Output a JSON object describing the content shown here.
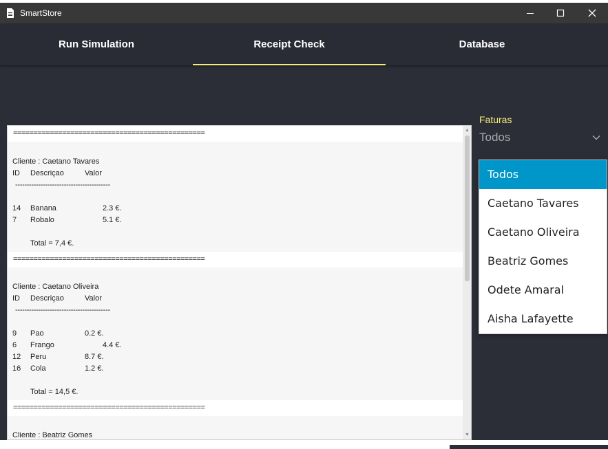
{
  "window": {
    "title": "SmartStore",
    "app_icon": "document-icon",
    "controls": [
      "minimize-icon",
      "maximize-icon",
      "close-icon"
    ]
  },
  "tabs": [
    {
      "label": "Run Simulation",
      "active": false
    },
    {
      "label": "Receipt Check",
      "active": true
    },
    {
      "label": "Database",
      "active": false
    }
  ],
  "colors": {
    "accent": "#f5ec7a",
    "selection": "#0096c9",
    "background": "#2b2e37"
  },
  "filter": {
    "label": "Faturas",
    "selected": "Todos",
    "options": [
      "Todos",
      "Caetano Tavares",
      "Caetano Oliveira",
      "Beatriz Gomes",
      "Odete Amaral",
      "Aisha Lafayette"
    ]
  },
  "receipt": {
    "separator": "===============================================",
    "header": {
      "id": "ID",
      "desc": "Descriçao",
      "val": "Valor"
    },
    "dash_line": "-----------------------------------------",
    "customers": [
      {
        "cliente": "Cliente : Caetano Tavares",
        "items": [
          {
            "id": "14",
            "desc": "Banana",
            "val": "2.3 €."
          },
          {
            "id": "7",
            "desc": "Robalo",
            "val": "5.1 €."
          }
        ],
        "total": "Total = 7,4 €."
      },
      {
        "cliente": "Cliente : Caetano Oliveira",
        "items": [
          {
            "id": "9",
            "desc": "Pao",
            "val": "0.2 €."
          },
          {
            "id": "6",
            "desc": "Frango",
            "val": "4.4 €."
          },
          {
            "id": "12",
            "desc": "Peru",
            "val": "8.7 €."
          },
          {
            "id": "16",
            "desc": "Cola",
            "val": "1.2 €."
          }
        ],
        "total": "Total = 14,5 €."
      },
      {
        "cliente": "Cliente : Beatriz Gomes",
        "items": [],
        "total": ""
      }
    ]
  }
}
